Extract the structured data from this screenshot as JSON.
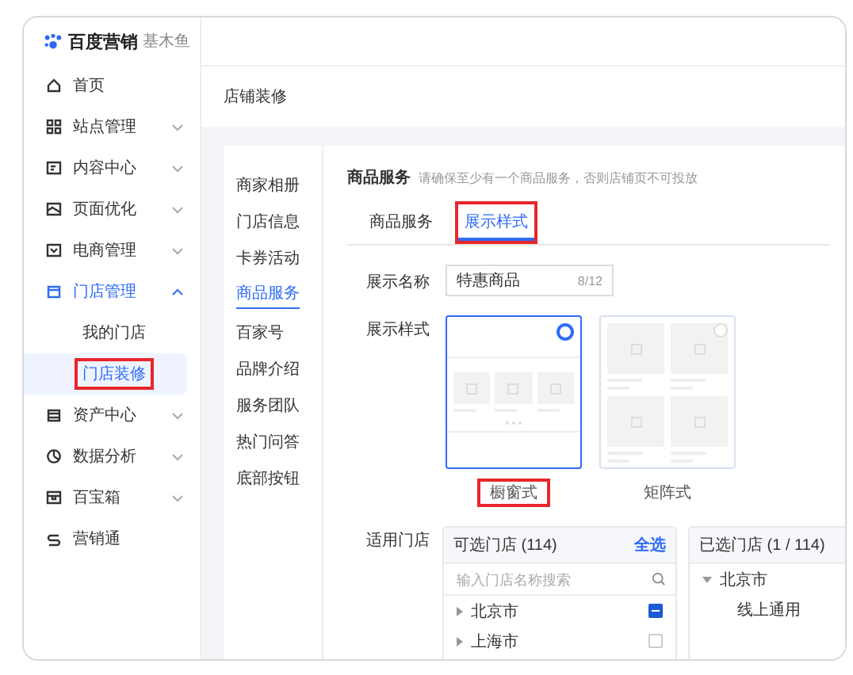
{
  "logo": {
    "brand": "百度营销",
    "product": "基木鱼"
  },
  "sidebar": {
    "items": [
      {
        "label": "首页",
        "selected": false
      },
      {
        "label": "站点管理",
        "expanded": false,
        "selected": false
      },
      {
        "label": "内容中心",
        "expanded": false,
        "selected": false
      },
      {
        "label": "页面优化",
        "expanded": false,
        "selected": false
      },
      {
        "label": "电商管理",
        "expanded": false,
        "selected": false
      },
      {
        "label": "门店管理",
        "expanded": true,
        "selected": true,
        "children": [
          {
            "label": "我的门店",
            "selected": false,
            "highlighted": false
          },
          {
            "label": "门店装修",
            "selected": true,
            "highlighted": true
          }
        ]
      },
      {
        "label": "资产中心",
        "expanded": false,
        "selected": false
      },
      {
        "label": "数据分析",
        "expanded": false,
        "selected": false
      },
      {
        "label": "百宝箱",
        "expanded": false,
        "selected": false
      },
      {
        "label": "营销通",
        "selected": false
      }
    ]
  },
  "page_title": "店铺装修",
  "submenu": [
    {
      "label": "商家相册",
      "selected": false
    },
    {
      "label": "门店信息",
      "selected": false
    },
    {
      "label": "卡券活动",
      "selected": false
    },
    {
      "label": "商品服务",
      "selected": true
    },
    {
      "label": "百家号",
      "selected": false
    },
    {
      "label": "品牌介绍",
      "selected": false
    },
    {
      "label": "服务团队",
      "selected": false
    },
    {
      "label": "热门问答",
      "selected": false
    },
    {
      "label": "底部按钮",
      "selected": false
    }
  ],
  "section": {
    "title": "商品服务",
    "hint": "请确保至少有一个商品服务，否则店铺页不可投放"
  },
  "tabs": [
    {
      "label": "商品服务",
      "selected": false,
      "highlighted": false
    },
    {
      "label": "展示样式",
      "selected": true,
      "highlighted": true
    }
  ],
  "name_field": {
    "label": "展示名称",
    "value": "特惠商品",
    "counter": "8/12"
  },
  "style_field": {
    "label": "展示样式",
    "options": [
      {
        "label": "橱窗式",
        "kind": "showcase",
        "selected": true,
        "highlighted": true
      },
      {
        "label": "矩阵式",
        "kind": "matrix",
        "selected": false,
        "highlighted": false
      }
    ]
  },
  "stores": {
    "label": "适用门店",
    "available": {
      "title": "可选门店 (114)",
      "select_all": "全选",
      "placeholder": "输入门店名称搜索",
      "rows": [
        {
          "name": "北京市",
          "partial": true
        },
        {
          "name": "上海市",
          "partial": false
        }
      ]
    },
    "chosen": {
      "title": "已选门店 (1 / 114)",
      "groups": [
        {
          "name": "北京市",
          "expanded": true,
          "children": [
            {
              "name": "线上通用"
            }
          ]
        }
      ]
    }
  }
}
